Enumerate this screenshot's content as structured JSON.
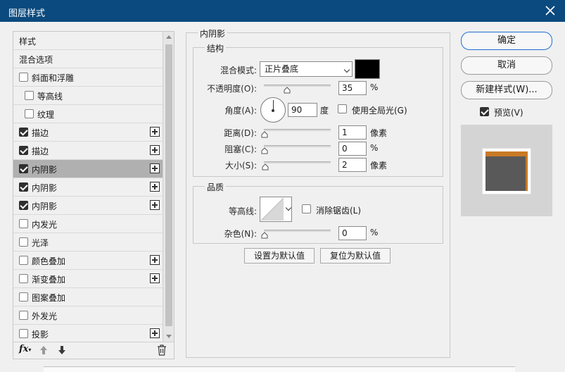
{
  "window": {
    "title": "图层样式"
  },
  "styles_list": [
    {
      "label": "样式",
      "checkbox": false,
      "checked": false,
      "plus": false,
      "indent": 0,
      "selected": false
    },
    {
      "label": "混合选项",
      "checkbox": false,
      "checked": false,
      "plus": false,
      "indent": 0,
      "selected": false
    },
    {
      "label": "斜面和浮雕",
      "checkbox": true,
      "checked": false,
      "plus": false,
      "indent": 0,
      "selected": false
    },
    {
      "label": "等高线",
      "checkbox": true,
      "checked": false,
      "plus": false,
      "indent": 1,
      "selected": false
    },
    {
      "label": "纹理",
      "checkbox": true,
      "checked": false,
      "plus": false,
      "indent": 1,
      "selected": false
    },
    {
      "label": "描边",
      "checkbox": true,
      "checked": true,
      "plus": true,
      "indent": 0,
      "selected": false
    },
    {
      "label": "描边",
      "checkbox": true,
      "checked": true,
      "plus": true,
      "indent": 0,
      "selected": false
    },
    {
      "label": "内阴影",
      "checkbox": true,
      "checked": true,
      "plus": true,
      "indent": 0,
      "selected": true
    },
    {
      "label": "内阴影",
      "checkbox": true,
      "checked": true,
      "plus": true,
      "indent": 0,
      "selected": false
    },
    {
      "label": "内阴影",
      "checkbox": true,
      "checked": true,
      "plus": true,
      "indent": 0,
      "selected": false
    },
    {
      "label": "内发光",
      "checkbox": true,
      "checked": false,
      "plus": false,
      "indent": 0,
      "selected": false
    },
    {
      "label": "光泽",
      "checkbox": true,
      "checked": false,
      "plus": false,
      "indent": 0,
      "selected": false
    },
    {
      "label": "颜色叠加",
      "checkbox": true,
      "checked": false,
      "plus": true,
      "indent": 0,
      "selected": false
    },
    {
      "label": "渐变叠加",
      "checkbox": true,
      "checked": false,
      "plus": true,
      "indent": 0,
      "selected": false
    },
    {
      "label": "图案叠加",
      "checkbox": true,
      "checked": false,
      "plus": false,
      "indent": 0,
      "selected": false
    },
    {
      "label": "外发光",
      "checkbox": true,
      "checked": false,
      "plus": false,
      "indent": 0,
      "selected": false
    },
    {
      "label": "投影",
      "checkbox": true,
      "checked": false,
      "plus": true,
      "indent": 0,
      "selected": false
    }
  ],
  "footer": {
    "fx_label": "fx"
  },
  "panel": {
    "title": "内阴影",
    "structure": {
      "title": "结构",
      "blend_mode_label": "混合模式:",
      "blend_mode_value": "正片叠底",
      "blend_color": "#000000",
      "opacity_label": "不透明度(O):",
      "opacity_value": "35",
      "opacity_unit": "%",
      "opacity_level": 0.35,
      "angle_label": "角度(A):",
      "angle_value": "90",
      "angle_unit": "度",
      "global_light_label": "使用全局光(G)",
      "global_light_checked": false,
      "distance_label": "距离(D):",
      "distance_value": "1",
      "distance_unit": "像素",
      "choke_label": "阻塞(C):",
      "choke_value": "0",
      "choke_unit": "%",
      "size_label": "大小(S):",
      "size_value": "2",
      "size_unit": "像素"
    },
    "quality": {
      "title": "品质",
      "contour_label": "等高线:",
      "antialias_label": "消除锯齿(L)",
      "antialias_checked": false,
      "noise_label": "杂色(N):",
      "noise_value": "0",
      "noise_unit": "%"
    },
    "set_default_label": "设置为默认值",
    "reset_default_label": "复位为默认值"
  },
  "right": {
    "ok_label": "确定",
    "cancel_label": "取消",
    "new_style_label": "新建样式(W)...",
    "preview_label": "预览(V)",
    "preview_checked": true,
    "preview_fill_color": "#595959",
    "preview_stroke_color": "#c87a26"
  }
}
